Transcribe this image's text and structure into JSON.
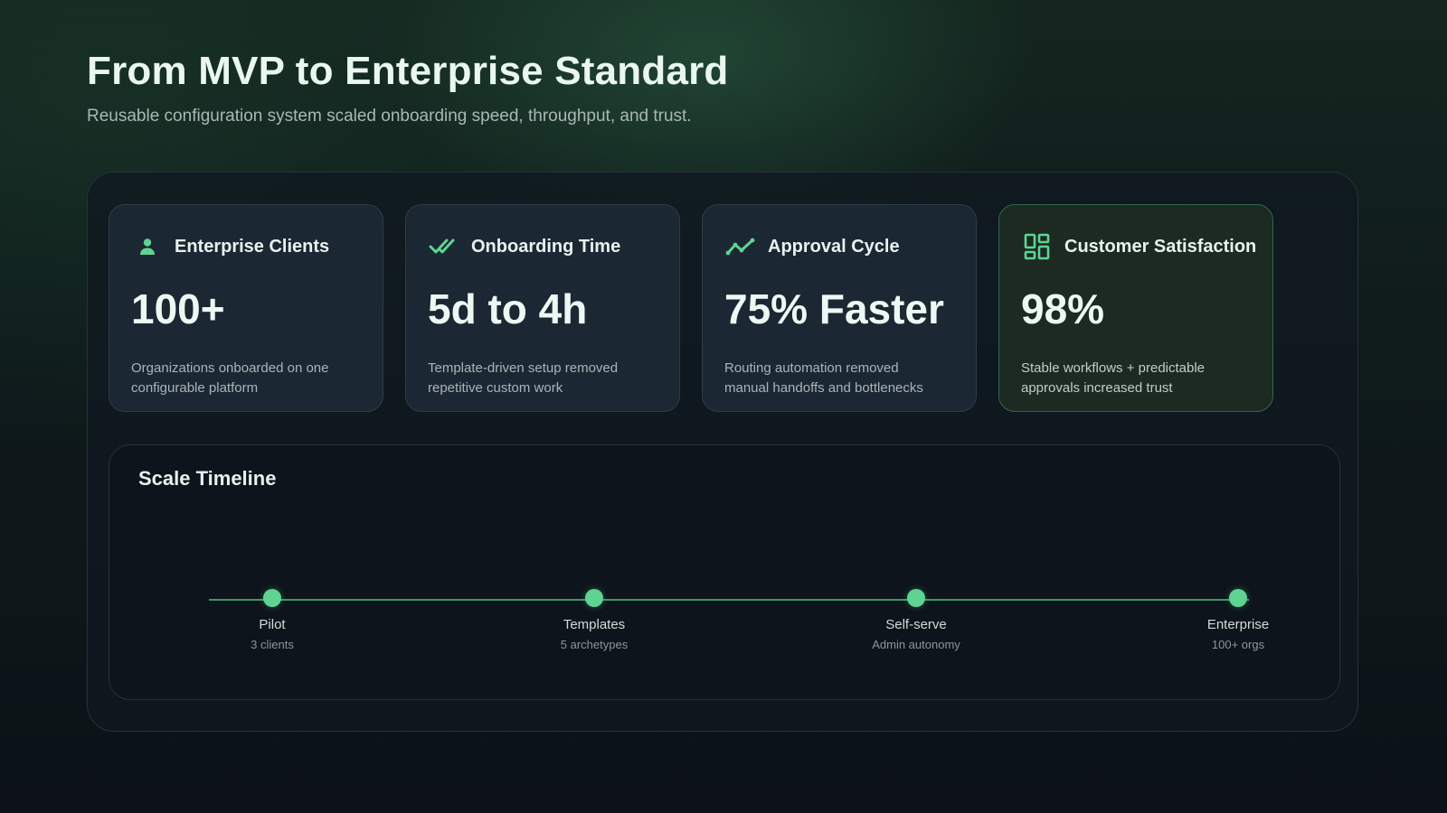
{
  "header": {
    "title": "From MVP to Enterprise Standard",
    "subtitle": "Reusable configuration system scaled onboarding speed, throughput, and trust."
  },
  "accent_color": "#5fd492",
  "metrics": [
    {
      "icon": "user-icon",
      "title": "Enterprise Clients",
      "value": "100+",
      "description": "Organizations onboarded on one configurable platform"
    },
    {
      "icon": "double-check-icon",
      "title": "Onboarding Time",
      "value": "5d to 4h",
      "description": "Template-driven setup removed repetitive custom work"
    },
    {
      "icon": "trend-line-icon",
      "title": "Approval Cycle",
      "value": "75% Faster",
      "description": "Routing automation removed manual handoffs and bottlenecks"
    },
    {
      "icon": "dashboard-grid-icon",
      "title": "Customer Satisfaction",
      "value": "98%",
      "description": "Stable workflows + predictable approvals increased trust"
    }
  ],
  "timeline": {
    "title": "Scale Timeline",
    "milestones": [
      {
        "label": "Pilot",
        "sub": "3 clients"
      },
      {
        "label": "Templates",
        "sub": "5 archetypes"
      },
      {
        "label": "Self-serve",
        "sub": "Admin autonomy"
      },
      {
        "label": "Enterprise",
        "sub": "100+ orgs"
      }
    ]
  }
}
